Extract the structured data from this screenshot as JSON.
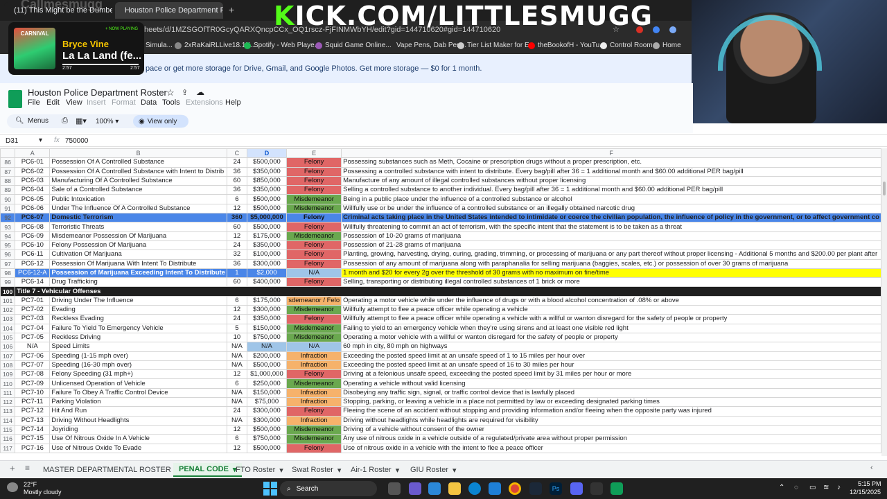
{
  "browser": {
    "tabs": [
      {
        "label": "(11) This Might be the Dumbes"
      },
      {
        "label": "Houston Police Department Ros"
      }
    ],
    "url": "heets/d/1MZSGOfTR0GcyQARXQncpCCx_OQ1rscz-FjFINMWbYH/edit?gid=144710620#gid=144710620",
    "bookmarks": [
      "Simula...",
      "2xRaKaiRLLive18.1K...",
      "Spotify - Web Playe...",
      "Squid Game Online...",
      "Vape Pens, Dab Pen...",
      "Tier List Maker for E...",
      "theBookofH - YouTu...",
      "Control Room",
      "Home"
    ],
    "banner": "pace or get more storage for Drive, Gmail, and Google Photos. Get more storage — $0 for 1 month."
  },
  "overlay": {
    "kick_prefix": "K",
    "kick_rest": "ICK.COM/LITTLESMUGG",
    "watermark": "Callmesmugg",
    "now_playing_badge": "+ NOW PLAYING",
    "artist": "Bryce Vine",
    "song": "La La Land (fe...",
    "album_art_text": "CARNIVAL",
    "time_elapsed": "2:57",
    "time_total": "2:57"
  },
  "doc": {
    "title": "Houston Police Department Roster",
    "menus": [
      "File",
      "Edit",
      "View",
      "Insert",
      "Format",
      "Data",
      "Tools",
      "Extensions",
      "Help"
    ],
    "disabled_menus": [
      "Insert",
      "Format",
      "Extensions"
    ],
    "toolbar": {
      "menus_label": "Menus",
      "zoom": "100%",
      "view_only": "View only"
    },
    "cell_ref": "D31",
    "formula": "750000"
  },
  "sheet": {
    "columns": [
      "A",
      "B",
      "C",
      "D",
      "E",
      "F"
    ],
    "rows": [
      {
        "n": "86",
        "a": "PC6-01",
        "b": "Possession Of A Controlled Substance",
        "c": "24",
        "d": "$500,000",
        "e": "Felony",
        "f": "Possessing substances such as Meth, Cocaine or prescription drugs without a proper prescription, etc."
      },
      {
        "n": "87",
        "a": "PC6-02",
        "b": "Possession Of A Controlled Substance with Intent to Distrib",
        "c": "36",
        "d": "$350,000",
        "e": "Felony",
        "f": "Possessing a controlled substance with intent to distribute. Every bag/pill after 36 = 1 additional month and $60.00 additional PER bag/pill"
      },
      {
        "n": "88",
        "a": "PC6-03",
        "b": "Manufacturing Of A Controlled Substance",
        "c": "60",
        "d": "$850,000",
        "e": "Felony",
        "f": "Manufacture of any amount of illegal controlled substances without proper licensing"
      },
      {
        "n": "89",
        "a": "PC6-04",
        "b": "Sale of a Controlled Substance",
        "c": "36",
        "d": "$350,000",
        "e": "Felony",
        "f": "Selling a controlled substance to another individual. Every bag/pill after 36 = 1 additional month and $60.00 additional PER bag/pill"
      },
      {
        "n": "90",
        "a": "PC6-05",
        "b": "Public Intoxication",
        "c": "6",
        "d": "$500,000",
        "e": "Misdemeanor",
        "f": "Being in a public place under the influence of a controlled substance or alcohol"
      },
      {
        "n": "91",
        "a": "PC6-06",
        "b": "Under The Influence Of A Controlled Substance",
        "c": "12",
        "d": "$500,000",
        "e": "Misdemeanor",
        "f": "Willfully use or be under the influence of a controlled substance or an illegally obtained narcotic drug"
      },
      {
        "n": "92",
        "a": "PC6-07",
        "b": "Domestic Terrorism",
        "c": "360",
        "d": "$5,000,000",
        "e": "Felony",
        "f": "Criminal acts taking place in the United States intended to intimidate or coerce the civilian population, the influence of policy in the government, or to affect government co",
        "style": "hl"
      },
      {
        "n": "93",
        "a": "PC6-08",
        "b": "Terroristic Threats",
        "c": "60",
        "d": "$500,000",
        "e": "Felony",
        "f": "Willfully threatening to commit an act of terrorism, with the specific intent that the statement is to be taken as a threat"
      },
      {
        "n": "94",
        "a": "PC6-09",
        "b": "Misdemeanor Possession Of Marijuana",
        "c": "12",
        "d": "$175,000",
        "e": "Misdemeanor",
        "f": "Possession of 10-20 grams of marijuana"
      },
      {
        "n": "95",
        "a": "PC6-10",
        "b": "Felony Possession Of Marijuana",
        "c": "24",
        "d": "$350,000",
        "e": "Felony",
        "f": "Possession of 21-28 grams of marijuana"
      },
      {
        "n": "96",
        "a": "PC6-11",
        "b": "Cultivation Of Marijuana",
        "c": "32",
        "d": "$100,000",
        "e": "Felony",
        "f": "Planting, growing, harvesting, drying, curing, grading, trimming, or processing of marijuana or any part thereof without proper licensing - Additional 5 months and $200.00 per plant after"
      },
      {
        "n": "97",
        "a": "PC6-12",
        "b": "Possession Of Marijuana With Intent To Distribute",
        "c": "36",
        "d": "$300,000",
        "e": "Felony",
        "f": "Possession of any amount of marijuana along with paraphanalia for selling marijuana (baggies, scales, etc.) or possession of over 30 grams of marijuana"
      },
      {
        "n": "98",
        "a": "PC6-12-A",
        "b": "Possession of Marijuana Exceeding Intent To Distribute",
        "c": "1",
        "d": "$2,000",
        "e": "N/A",
        "f": "1 month and $20 for every 2g over the threshold of 30 grams with no maximum on fine/time",
        "style": "mixed"
      },
      {
        "n": "99",
        "a": "PC6-14",
        "b": "Drug Trafficking",
        "c": "60",
        "d": "$400,000",
        "e": "Felony",
        "f": "Selling, transporting or distributing illegal controlled substances of 1 brick or more"
      },
      {
        "n": "100",
        "section": "Title 7 - Vehicular Offenses"
      },
      {
        "n": "101",
        "a": "PC7-01",
        "b": "Driving Under The Influence",
        "c": "6",
        "d": "$175,000",
        "e": "sdemeanor / Felo",
        "f": "Operating a motor vehicle while under the influence of drugs or with a blood alcohol concentration of .08% or above"
      },
      {
        "n": "102",
        "a": "PC7-02",
        "b": "Evading",
        "c": "12",
        "d": "$300,000",
        "e": "Misdemeanor",
        "f": "Willfully attempt to flee a peace officer while operating a vehicle"
      },
      {
        "n": "103",
        "a": "PC7-03",
        "b": "Reckless Evading",
        "c": "24",
        "d": "$350,000",
        "e": "Felony",
        "f": "Willfully attempt to flee a peace officer while operating a vehicle with a willful or wanton disregard for the safety of people or property"
      },
      {
        "n": "104",
        "a": "PC7-04",
        "b": "Failure To Yield To Emergency Vehicle",
        "c": "5",
        "d": "$150,000",
        "e": "Misdemeanor",
        "f": "Failing to yield to an emergency vehicle when they're using sirens and at least one visible red light"
      },
      {
        "n": "105",
        "a": "PC7-05",
        "b": "Reckless Driving",
        "c": "10",
        "d": "$750,000",
        "e": "Misdemeanor",
        "f": "Operating a motor vehicle with a willful or wanton disregard for the safety of people or property"
      },
      {
        "n": "106",
        "a": "N/A",
        "b": "Speed Limits",
        "c": "N/A",
        "d": "N/A",
        "e": "N/A",
        "f": "60 mph in city, 80 mph on highways",
        "dstyle": "na",
        "estyle": "na"
      },
      {
        "n": "107",
        "a": "PC7-06",
        "b": "Speeding (1-15 mph over)",
        "c": "N/A",
        "d": "$200,000",
        "e": "Infraction",
        "f": "Exceeding the posted speed limit at an unsafe speed of 1 to 15 miles per hour over"
      },
      {
        "n": "108",
        "a": "PC7-07",
        "b": "Speeding (16-30 mph over)",
        "c": "N/A",
        "d": "$500,000",
        "e": "Infraction",
        "f": "Exceeding the posted speed limit at an unsafe speed of 16 to 30 miles per hour"
      },
      {
        "n": "109",
        "a": "PC7-08",
        "b": "Felony Speeding (31 mph+)",
        "c": "12",
        "d": "$1,000,000",
        "e": "Felony",
        "f": "Driving at a felonious unsafe speed, exceeding the posted speed limit by 31 miles per hour or more"
      },
      {
        "n": "110",
        "a": "PC7-09",
        "b": "Unlicensed Operation of Vehicle",
        "c": "6",
        "d": "$250,000",
        "e": "Misdemeanor",
        "f": "Operating a vehicle without valid licensing"
      },
      {
        "n": "111",
        "a": "PC7-10",
        "b": "Failure To Obey A Traffic Control Device",
        "c": "N/A",
        "d": "$150,000",
        "e": "Infraction",
        "f": "Disobeying any traffic sign, signal, or traffic control device that is lawfully placed"
      },
      {
        "n": "112",
        "a": "PC7-11",
        "b": "Parking Violation",
        "c": "N/A",
        "d": "$75,000",
        "e": "Infraction",
        "f": "Stopping, parking, or leaving a vehicle in a place not permitted by law or exceeding designated parking times"
      },
      {
        "n": "113",
        "a": "PC7-12",
        "b": "Hit And Run",
        "c": "24",
        "d": "$300,000",
        "e": "Felony",
        "f": "Fleeing the scene of an accident without stopping and providing information and/or fleeing when the opposite party was injured"
      },
      {
        "n": "114",
        "a": "PC7-13",
        "b": "Driving Without Headlights",
        "c": "N/A",
        "d": "$300,000",
        "e": "Infraction",
        "f": "Driving without headlights while headlights are required for visibility"
      },
      {
        "n": "115",
        "a": "PC7-14",
        "b": "Joyriding",
        "c": "12",
        "d": "$500,000",
        "e": "Misdemeanor",
        "f": "Driving of a vehicle without consent of the owner"
      },
      {
        "n": "116",
        "a": "PC7-15",
        "b": "Use Of Nitrous Oxide In A Vehicle",
        "c": "6",
        "d": "$750,000",
        "e": "Misdemeanor",
        "f": "Any use of nitrous oxide in a vehicle outside of a regulated/private area without proper permission"
      },
      {
        "n": "117",
        "a": "PC7-16",
        "b": "Use of Nitrous Oxide To Evade",
        "c": "12",
        "d": "$500,000",
        "e": "Felony",
        "f": "Use of nitrous oxide in a vehicle with the intent to flee a peace officer"
      }
    ]
  },
  "sheet_tabs": [
    {
      "label": "MASTER DEPARTMENTAL ROSTER",
      "active": false
    },
    {
      "label": "PENAL CODE",
      "active": true
    },
    {
      "label": "FTO Roster",
      "active": false
    },
    {
      "label": "Swat Roster",
      "active": false
    },
    {
      "label": "Air-1 Roster",
      "active": false
    },
    {
      "label": "GIU Roster",
      "active": false
    }
  ],
  "taskbar": {
    "temp": "22°F",
    "weather": "Mostly cloudy",
    "search": "Search",
    "time": "5:15 PM",
    "date": "12/15/2025"
  },
  "colors": {
    "felony": "#e06666",
    "misdemeanor": "#6aa84f",
    "infraction": "#f6b26b",
    "highlight_blue": "#4a86e8",
    "highlight_yellow": "#ffff00",
    "section": "#1f1f1f",
    "sheets_green": "#188038"
  }
}
